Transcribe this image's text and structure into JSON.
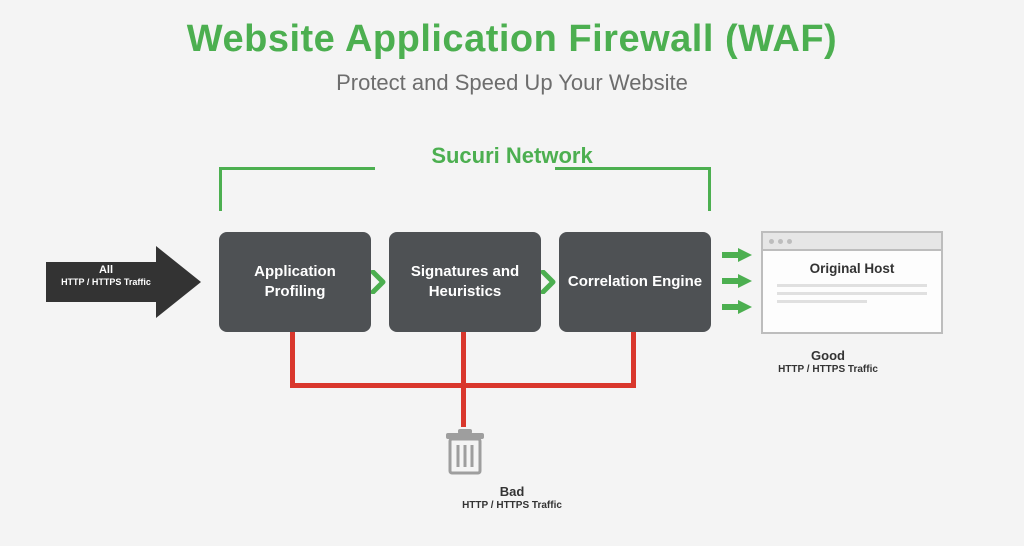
{
  "title": "Website Application Firewall (WAF)",
  "subtitle": "Protect and Speed Up Your Website",
  "network_label": "Sucuri Network",
  "input": {
    "line1": "All",
    "line2": "HTTP / HTTPS Traffic"
  },
  "boxes": {
    "b1": "Application Profiling",
    "b2": "Signatures and Heuristics",
    "b3": "Correlation Engine"
  },
  "host": {
    "title": "Original Host"
  },
  "good": {
    "line1": "Good",
    "line2": "HTTP / HTTPS Traffic"
  },
  "bad": {
    "line1": "Bad",
    "line2": "HTTP / HTTPS Traffic"
  },
  "colors": {
    "green": "#4caf50",
    "red": "#d9372c",
    "boxgrey": "#4e5154",
    "dark": "#333333",
    "chrome": "#bdbdbd"
  }
}
